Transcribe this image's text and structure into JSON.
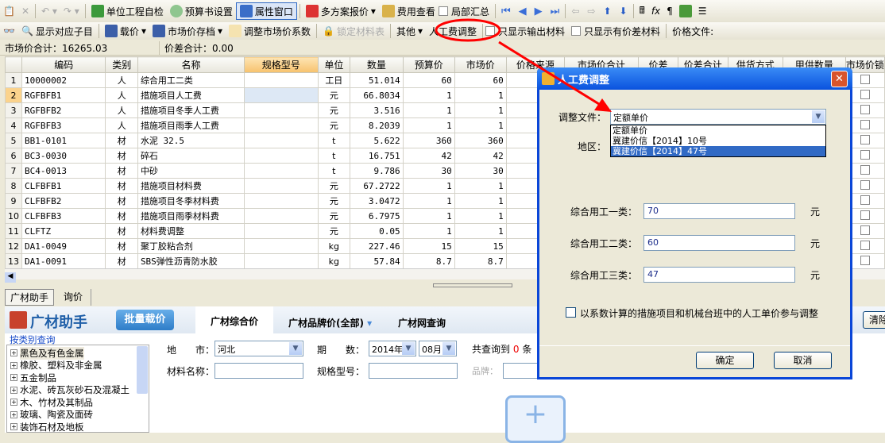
{
  "toolbar1": {
    "items": [
      "单位工程自检",
      "预算书设置",
      "属性窗口",
      "多方案报价",
      "费用查看",
      "局部汇总"
    ]
  },
  "toolbar2": {
    "items": [
      "显示对应子目",
      "载价",
      "市场价存档",
      "调整市场价系数",
      "锁定材料表",
      "其他",
      "人工费调整",
      "只显示输出材料",
      "只显示有价差材料",
      "价格文件:"
    ]
  },
  "summary": {
    "market_total": "市场价合计：16265.03",
    "diff_total": "价差合计：0.00"
  },
  "grid": {
    "columns": [
      "编码",
      "类别",
      "名称",
      "规格型号",
      "单位",
      "数量",
      "预算价",
      "市场价",
      "价格来源",
      "市场价合计",
      "价差",
      "价差合计",
      "供货方式",
      "甲供数量",
      "市场价锁"
    ],
    "rows": [
      [
        "1",
        "10000002",
        "人",
        "综合用工二类",
        "",
        "工日",
        "51.014",
        "60",
        "60"
      ],
      [
        "2",
        "RGFBFB1",
        "人",
        "措施项目人工费",
        "",
        "元",
        "66.8034",
        "1",
        "1"
      ],
      [
        "3",
        "RGFBFB2",
        "人",
        "措施项目冬季人工费",
        "",
        "元",
        "3.516",
        "1",
        "1"
      ],
      [
        "4",
        "RGFBFB3",
        "人",
        "措施项目雨季人工费",
        "",
        "元",
        "8.2039",
        "1",
        "1"
      ],
      [
        "5",
        "BB1-0101",
        "材",
        "水泥 32.5",
        "",
        "t",
        "5.622",
        "360",
        "360"
      ],
      [
        "6",
        "BC3-0030",
        "材",
        "碎石",
        "",
        "t",
        "16.751",
        "42",
        "42"
      ],
      [
        "7",
        "BC4-0013",
        "材",
        "中砂",
        "",
        "t",
        "9.786",
        "30",
        "30"
      ],
      [
        "8",
        "CLFBFB1",
        "材",
        "措施项目材料费",
        "",
        "元",
        "67.2722",
        "1",
        "1"
      ],
      [
        "9",
        "CLFBFB2",
        "材",
        "措施项目冬季材料费",
        "",
        "元",
        "3.0472",
        "1",
        "1"
      ],
      [
        "10",
        "CLFBFB3",
        "材",
        "措施项目雨季材料费",
        "",
        "元",
        "6.7975",
        "1",
        "1"
      ],
      [
        "11",
        "CLFTZ",
        "材",
        "材料费调整",
        "",
        "元",
        "0.05",
        "1",
        "1"
      ],
      [
        "12",
        "DA1-0049",
        "材",
        "聚丁胶粘合剂",
        "",
        "kg",
        "227.46",
        "15",
        "15"
      ],
      [
        "13",
        "DA1-0091",
        "材",
        "SBS弹性沥青防水胶",
        "",
        "kg",
        "57.84",
        "8.7",
        "8.7"
      ]
    ]
  },
  "bottom_tabs": [
    "广材助手",
    "询价"
  ],
  "assistant": {
    "logo": "广材助手",
    "batch_button": "批量载价",
    "tabs": [
      "广材综合价",
      "广材品牌价(全部)",
      "广材网查询"
    ],
    "category_link": "按类别查询",
    "tree": [
      "黑色及有色金属",
      "橡胶、塑料及非金属",
      "五金制品",
      "水泥、砖瓦灰砂石及混凝土",
      "木、竹材及其制品",
      "玻璃、陶瓷及面砖",
      "装饰石材及地板"
    ],
    "city_label": "地　　市：",
    "city_value": "河北",
    "period_label": "期　　数：",
    "year": "2014年",
    "month": "08月",
    "result_prefix": "共查询到",
    "result_count": "0",
    "result_suffix": "条",
    "name_label": "材料名称：",
    "spec_label": "规格型号：",
    "brand_label": "品牌：",
    "clear_button": "清除"
  },
  "dialog": {
    "title": "人工费调整",
    "file_label": "调整文件：",
    "file_value": "定额单价",
    "options": [
      "定额单价",
      "冀建价信【2014】10号",
      "冀建价信【2014】47号"
    ],
    "selected_option": 2,
    "region_label": "地区：",
    "fields": [
      {
        "label": "综合用工一类：",
        "value": "70",
        "unit": "元"
      },
      {
        "label": "综合用工二类：",
        "value": "60",
        "unit": "元"
      },
      {
        "label": "综合用工三类：",
        "value": "47",
        "unit": "元"
      }
    ],
    "checkbox_label": "以系数计算的措施项目和机械台班中的人工单价参与调整",
    "checkbox_checked": false,
    "ok": "确定",
    "cancel": "取消"
  },
  "colors": {
    "dialog_title": "#0a52de",
    "annotation": "#ff0000",
    "selection": "#316ac5"
  }
}
